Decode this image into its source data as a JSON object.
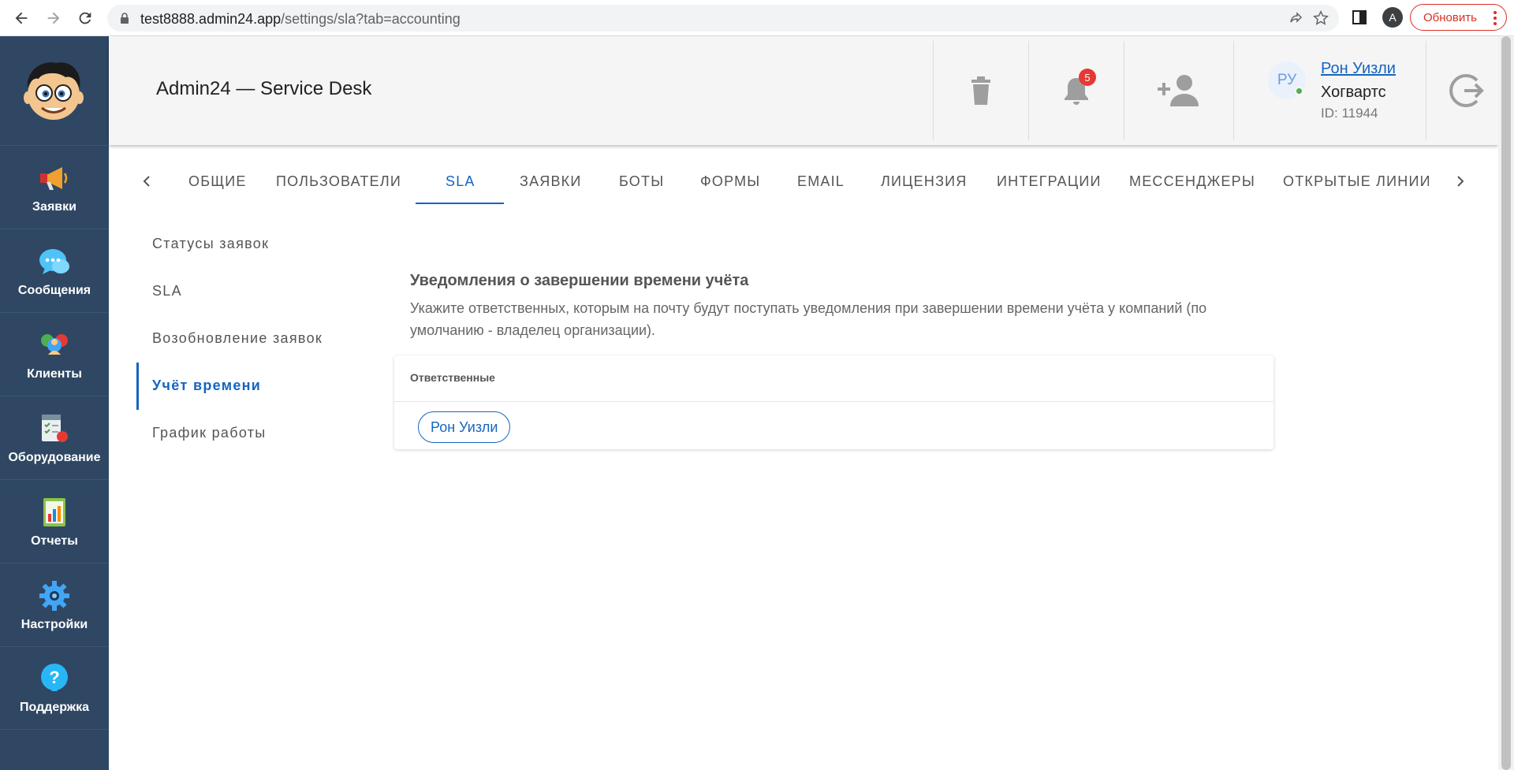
{
  "browser": {
    "url_host": "test8888.admin24.app",
    "url_path": "/settings/sla?tab=accounting",
    "profile_initial": "A",
    "update_label": "Обновить"
  },
  "sidebar": {
    "items": [
      {
        "label": "Заявки",
        "icon": "megaphone-icon"
      },
      {
        "label": "Сообщения",
        "icon": "chat-bubbles-icon"
      },
      {
        "label": "Клиенты",
        "icon": "clients-icon"
      },
      {
        "label": "Оборудование",
        "icon": "equipment-icon"
      },
      {
        "label": "Отчеты",
        "icon": "reports-icon"
      },
      {
        "label": "Настройки",
        "icon": "gear-icon"
      },
      {
        "label": "Поддержка",
        "icon": "help-icon"
      }
    ]
  },
  "header": {
    "title": "Admin24 — Service Desk",
    "notifications_count": "5",
    "user": {
      "initials": "РУ",
      "name": "Рон Уизли",
      "company": "Хогвартс",
      "id": "ID: 11944"
    }
  },
  "tabs": [
    "Общие",
    "Пользователи",
    "SLA",
    "Заявки",
    "Боты",
    "Формы",
    "Email",
    "Лицензия",
    "Интеграции",
    "Мессенджеры",
    "Открытые линии"
  ],
  "active_tab": "SLA",
  "submenu": [
    "Статусы заявок",
    "SLA",
    "Возобновление заявок",
    "Учёт времени",
    "График работы"
  ],
  "active_submenu": "Учёт времени",
  "content": {
    "title": "Уведомления о завершении времени учёта",
    "description": "Укажите ответственных, которым на почту будут поступать уведомления при завершении времени учёта у компаний (по умолчанию - владелец организации).",
    "table_header": "Ответственные",
    "responsible": [
      "Рон Уизли"
    ]
  },
  "colors": {
    "accent": "#1565c0",
    "sidebar_bg": "#2f4763",
    "badge": "#e53935"
  }
}
